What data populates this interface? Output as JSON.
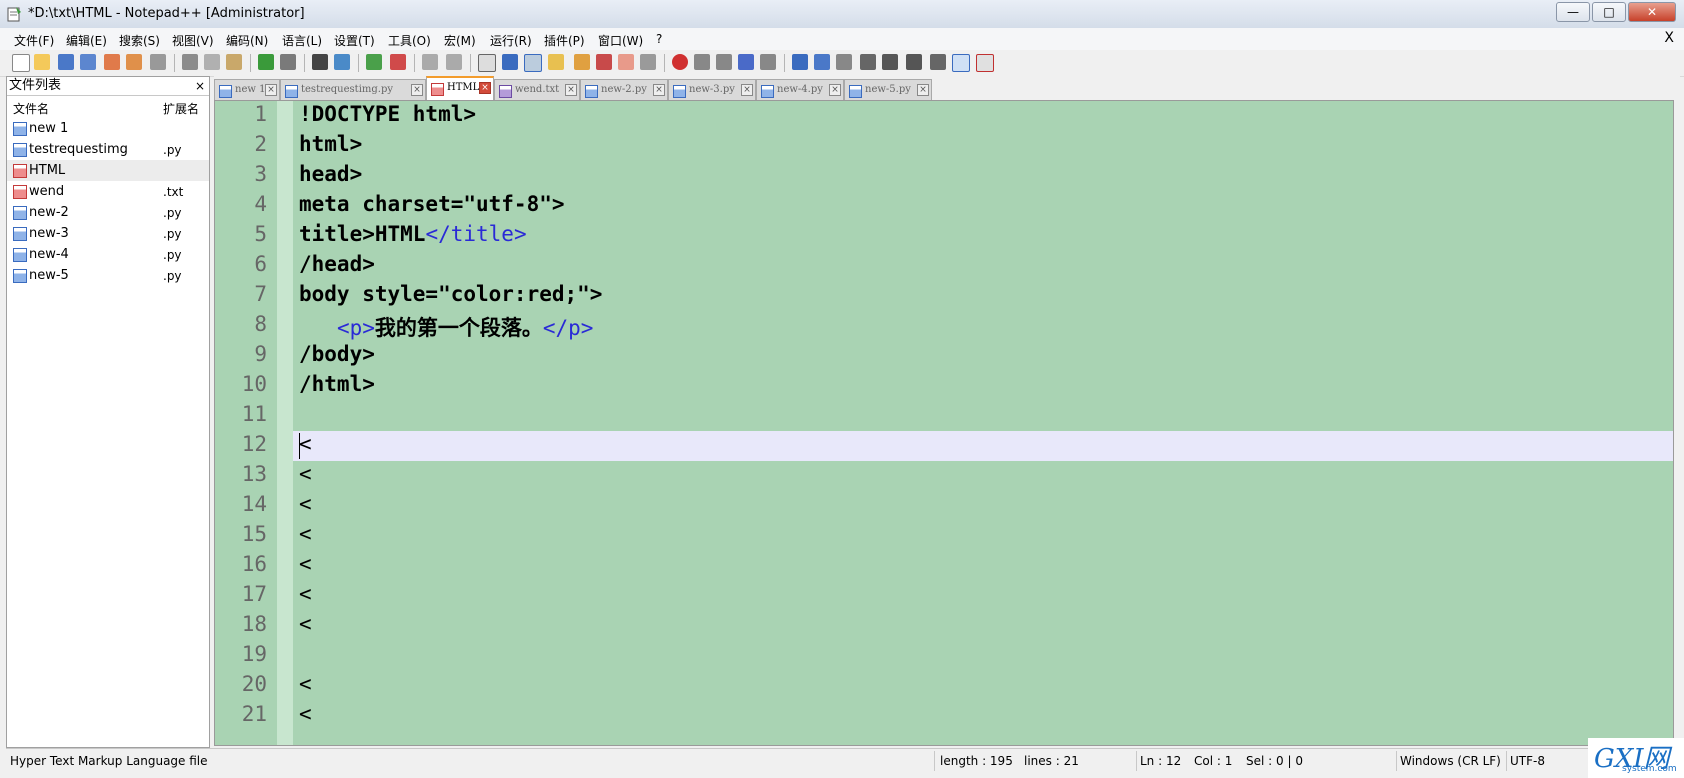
{
  "window": {
    "title": "*D:\\txt\\HTML - Notepad++ [Administrator]",
    "buttons": {
      "minimize": "—",
      "maximize": "□",
      "close": "✕"
    }
  },
  "menu": {
    "items": [
      "文件(F)",
      "编辑(E)",
      "搜索(S)",
      "视图(V)",
      "编码(N)",
      "语言(L)",
      "设置(T)",
      "工具(O)",
      "宏(M)",
      "运行(R)",
      "插件(P)",
      "窗口(W)",
      "?"
    ],
    "close": "X"
  },
  "toolbar": {
    "icons": [
      "new-file",
      "open-file",
      "save",
      "save-all",
      "close",
      "close-all",
      "print",
      "cut",
      "copy",
      "paste",
      "undo",
      "redo",
      "find",
      "replace",
      "zoom-in",
      "zoom-out",
      "sync-vertical",
      "sync-horizontal",
      "word-wrap",
      "show-all-chars",
      "indent-guide",
      "user-lang",
      "doc-map",
      "function-list",
      "folder-workspace",
      "monitor",
      "record-macro",
      "stop-macro",
      "play-macro",
      "run-macro-multiple",
      "save-macro",
      "launch-browser",
      "column-view",
      "compare",
      "fold-all",
      "move-up",
      "move-down",
      "summary",
      "panel-toggle",
      "spell-check"
    ]
  },
  "file_panel": {
    "title": "文件列表",
    "close": "×",
    "col_name": "文件名",
    "col_ext": "扩展名",
    "files": [
      {
        "name": "new 1",
        "ext": "",
        "icon": "blue"
      },
      {
        "name": "testrequestimg",
        "ext": ".py",
        "icon": "blue"
      },
      {
        "name": "HTML",
        "ext": "",
        "icon": "red"
      },
      {
        "name": "wend",
        "ext": ".txt",
        "icon": "red"
      },
      {
        "name": "new-2",
        "ext": ".py",
        "icon": "blue"
      },
      {
        "name": "new-3",
        "ext": ".py",
        "icon": "blue"
      },
      {
        "name": "new-4",
        "ext": ".py",
        "icon": "blue"
      },
      {
        "name": "new-5",
        "ext": ".py",
        "icon": "blue"
      }
    ]
  },
  "tabs": [
    {
      "label": "new 1",
      "icon": "blue"
    },
    {
      "label": "testrequestimg.py",
      "icon": "blue"
    },
    {
      "label": "HTML",
      "icon": "red",
      "active": true
    },
    {
      "label": "wend.txt",
      "icon": "purple"
    },
    {
      "label": "new-2.py",
      "icon": "blue"
    },
    {
      "label": "new-3.py",
      "icon": "blue"
    },
    {
      "label": "new-4.py",
      "icon": "blue"
    },
    {
      "label": "new-5.py",
      "icon": "blue"
    }
  ],
  "editor": {
    "current_line": 12,
    "lines": [
      {
        "n": "1",
        "parts": [
          {
            "t": "!DOCTYPE html>",
            "c": "b"
          }
        ]
      },
      {
        "n": "2",
        "parts": [
          {
            "t": "html>",
            "c": "b"
          }
        ]
      },
      {
        "n": "3",
        "parts": [
          {
            "t": "head>",
            "c": "b"
          }
        ]
      },
      {
        "n": "4",
        "parts": [
          {
            "t": "meta charset=\"utf-8\">",
            "c": "b"
          }
        ]
      },
      {
        "n": "5",
        "parts": [
          {
            "t": "title>HTML",
            "c": "b"
          },
          {
            "t": "</title>",
            "c": "tag"
          }
        ]
      },
      {
        "n": "6",
        "parts": [
          {
            "t": "/head>",
            "c": "b"
          }
        ]
      },
      {
        "n": "7",
        "parts": [
          {
            "t": "body style=\"color:red;\">",
            "c": "b"
          }
        ]
      },
      {
        "n": "8",
        "parts": [
          {
            "t": "   ",
            "c": "b"
          },
          {
            "t": "<p>",
            "c": "tag"
          },
          {
            "t": "我的第一个段落。",
            "c": "b"
          },
          {
            "t": "</p>",
            "c": "tag"
          }
        ]
      },
      {
        "n": "9",
        "parts": [
          {
            "t": "/body>",
            "c": "b"
          }
        ]
      },
      {
        "n": "10",
        "parts": [
          {
            "t": "/html>",
            "c": "b"
          }
        ]
      },
      {
        "n": "11",
        "parts": []
      },
      {
        "n": "12",
        "parts": [
          {
            "t": "<",
            "c": "n"
          }
        ]
      },
      {
        "n": "13",
        "parts": [
          {
            "t": "<",
            "c": "n"
          }
        ]
      },
      {
        "n": "14",
        "parts": [
          {
            "t": "<",
            "c": "n"
          }
        ]
      },
      {
        "n": "15",
        "parts": [
          {
            "t": "<",
            "c": "n"
          }
        ]
      },
      {
        "n": "16",
        "parts": [
          {
            "t": "<",
            "c": "n"
          }
        ]
      },
      {
        "n": "17",
        "parts": [
          {
            "t": "<",
            "c": "n"
          }
        ]
      },
      {
        "n": "18",
        "parts": [
          {
            "t": "<",
            "c": "n"
          }
        ]
      },
      {
        "n": "19",
        "parts": []
      },
      {
        "n": "20",
        "parts": [
          {
            "t": "<",
            "c": "n"
          }
        ]
      },
      {
        "n": "21",
        "parts": [
          {
            "t": "<",
            "c": "n"
          }
        ]
      }
    ]
  },
  "status": {
    "file_type": "Hyper Text Markup Language file",
    "length": "length : 195",
    "lines": "lines : 21",
    "ln": "Ln : 12",
    "col": "Col : 1",
    "sel": "Sel : 0 | 0",
    "eol": "Windows (CR LF)",
    "encoding": "UTF-8"
  },
  "watermark": {
    "big": "GXI网",
    "small": "system.com"
  },
  "colors": {
    "editor_bg": "#a9d3b3",
    "tag_color": "#2a2ad6",
    "current_line": "#e8e8fa",
    "active_tab_accent": "#f39c2c"
  }
}
